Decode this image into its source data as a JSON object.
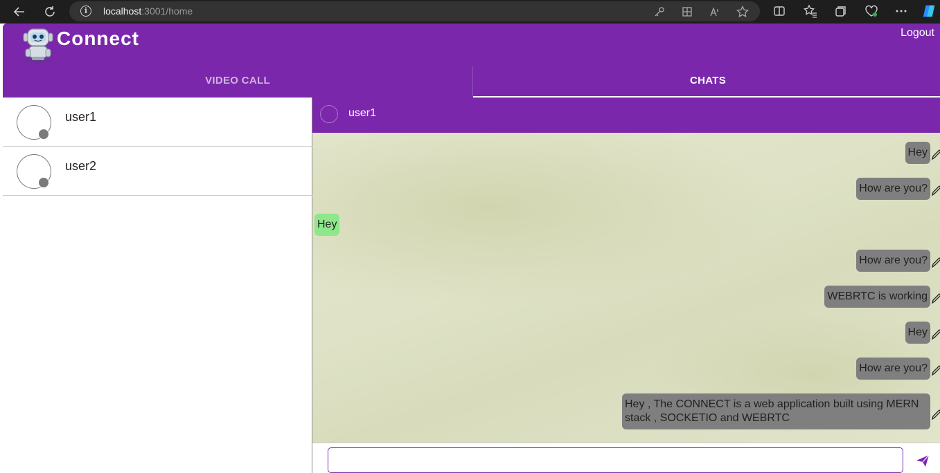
{
  "browser": {
    "url_host": "localhost",
    "url_path": ":3001/home"
  },
  "app": {
    "brand": "Connect",
    "logout_label": "Logout",
    "tabs": [
      {
        "label": "VIDEO CALL",
        "active": false
      },
      {
        "label": "CHATS",
        "active": true
      }
    ]
  },
  "sidebar": {
    "contacts": [
      {
        "name": "user1",
        "status": "offline"
      },
      {
        "name": "user2",
        "status": "offline"
      }
    ]
  },
  "chat": {
    "title": "user1",
    "messages": [
      {
        "text": "Hey",
        "direction": "out"
      },
      {
        "text": "How are you?",
        "direction": "out"
      },
      {
        "text": "Hey",
        "direction": "in"
      },
      {
        "text": "How are you?",
        "direction": "out"
      },
      {
        "text": "WEBRTC is working",
        "direction": "out"
      },
      {
        "text": "Hey",
        "direction": "out"
      },
      {
        "text": "How are you?",
        "direction": "out"
      },
      {
        "text": "Hey , The CONNECT is a web application built using MERN stack , SOCKETIO and WEBRTC",
        "direction": "out"
      }
    ],
    "input_value": "",
    "input_placeholder": ""
  },
  "colors": {
    "primary": "#7b27ac",
    "outgoing_bubble": "#7f7f7f",
    "incoming_bubble": "#8ee78a",
    "status_offline": "#7a7a7a"
  },
  "icons": {
    "back": "back-arrow-icon",
    "refresh": "refresh-icon",
    "info": "site-info-icon",
    "edit": "pencil-icon",
    "send": "send-icon"
  }
}
